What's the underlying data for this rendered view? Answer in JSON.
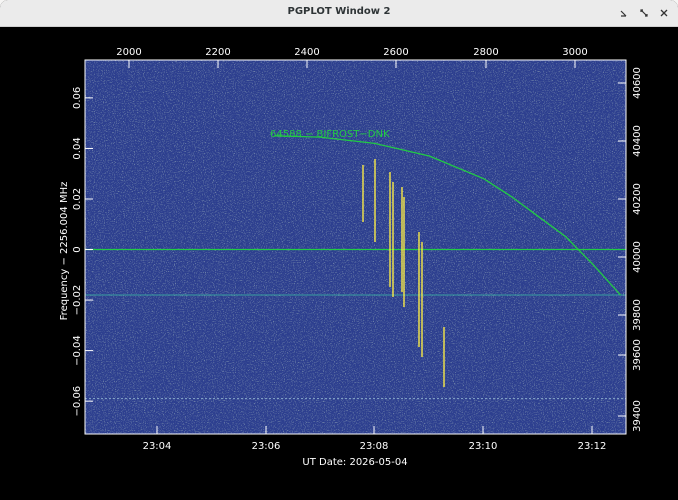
{
  "window": {
    "title": "PGPLOT Window 2",
    "buttons": [
      "minimize",
      "maximize",
      "close"
    ]
  },
  "plot": {
    "xlabel": "UT Date: 2026-05-04",
    "ylabel": "Frequency − 2256.004 MHz",
    "annotation": "64588 − BIFROST−DNK",
    "colors": {
      "background": "#2d3f8f",
      "frame": "#ffffff",
      "curve": "#22cc44",
      "signal": "#ffee44"
    }
  },
  "chart_data": {
    "type": "heatmap",
    "bottom_axis": {
      "label": "UT Date: 2026-05-04",
      "ticks": [
        "23:04",
        "23:06",
        "23:08",
        "23:10",
        "23:12"
      ]
    },
    "top_axis": {
      "ticks": [
        "2000",
        "2200",
        "2400",
        "2600",
        "2800",
        "3000"
      ]
    },
    "left_axis": {
      "label": "Frequency − 2256.004 MHz",
      "ticks": [
        "−0.06",
        "−0.04",
        "−0.02",
        "0",
        "0.02",
        "0.04",
        "0.06"
      ],
      "range": [
        -0.073,
        0.075
      ]
    },
    "right_axis": {
      "ticks": [
        "39400",
        "39600",
        "39800",
        "40000",
        "40200",
        "40400",
        "40600"
      ]
    },
    "doppler_curve": {
      "x_time": [
        "23:06:10",
        "23:07",
        "23:08",
        "23:09",
        "23:10",
        "23:10:30",
        "23:11",
        "23:11:30",
        "23:12",
        "23:12:30"
      ],
      "y_freq": [
        0.045,
        0.0445,
        0.042,
        0.037,
        0.028,
        0.021,
        0.013,
        0.005,
        -0.006,
        -0.018
      ]
    },
    "horizontal_lines": [
      0.0,
      -0.018,
      -0.059
    ],
    "annotation": "64588 − BIFROST−DNK"
  }
}
